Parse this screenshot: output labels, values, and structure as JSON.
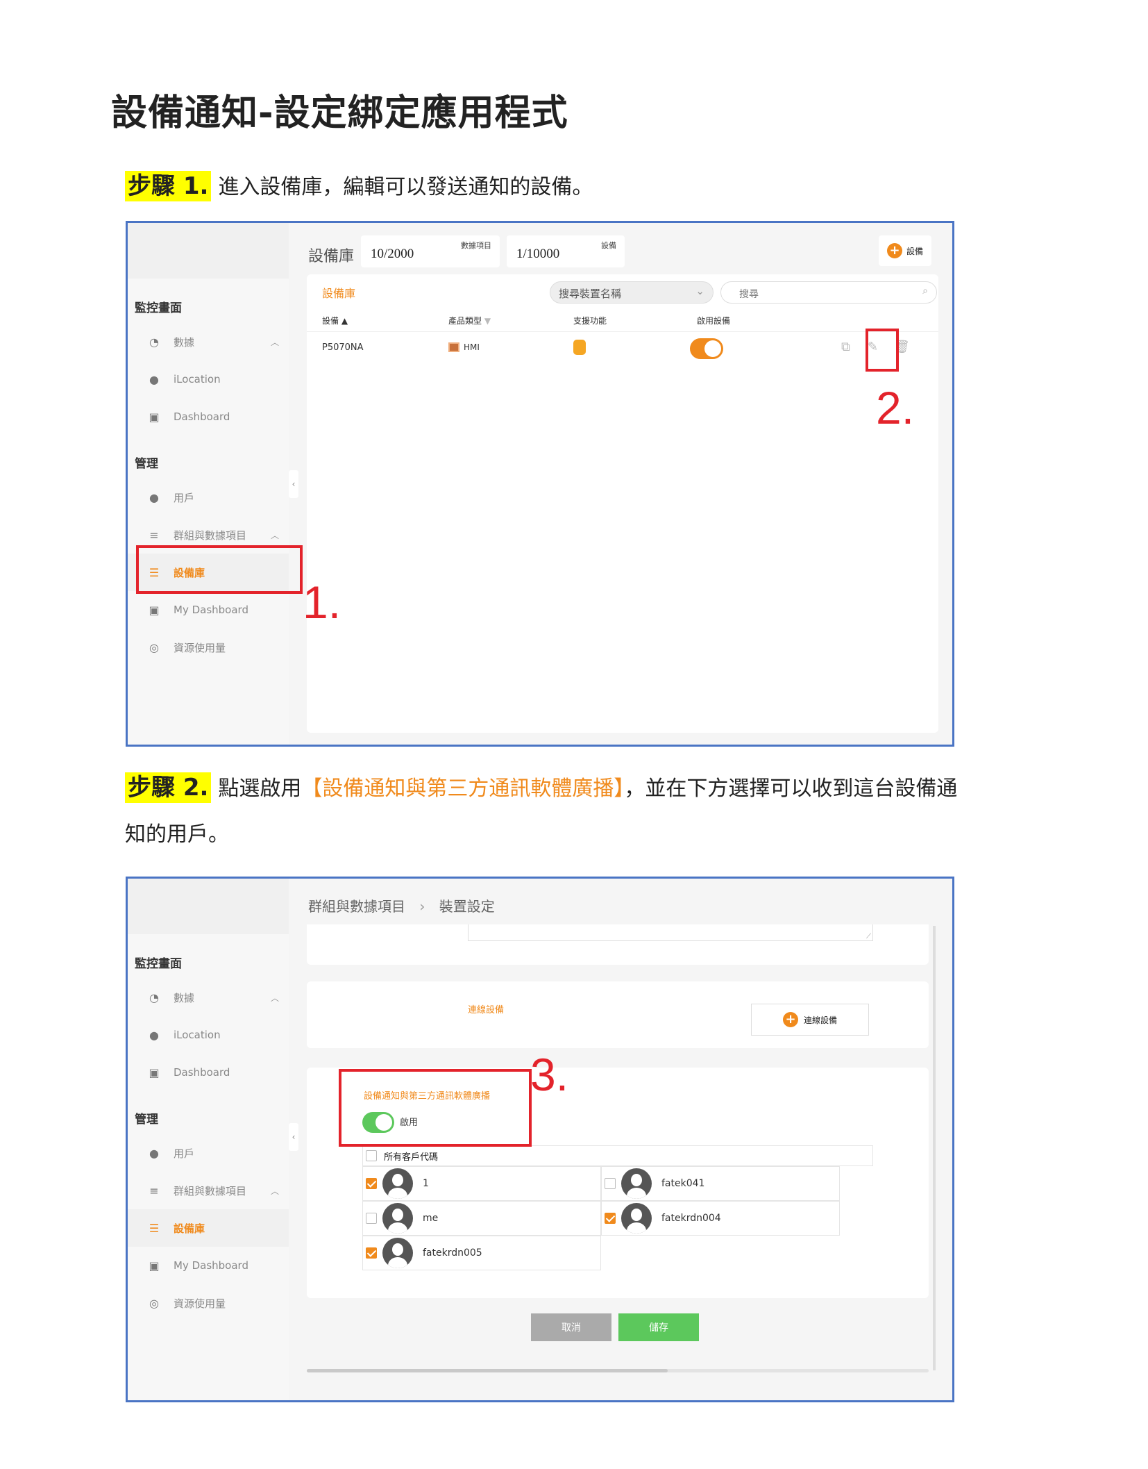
{
  "doc_title": "設備通知-設定綁定應用程式",
  "step1": {
    "tag": "步驟 1.",
    "text": "進入設備庫，編輯可以發送通知的設備。"
  },
  "step2": {
    "tag": "步驟 2.",
    "text_a": "點選啟用",
    "highlight": "【設備通知與第三方通訊軟體廣播】",
    "text_b": "，並在下方選擇可以收到這台設備通",
    "text_c": "知的用戶。"
  },
  "sidebar": {
    "section_monitor": "監控畫面",
    "section_manage": "管理",
    "items": [
      {
        "label": "數據",
        "icon": "dashboard-gauge-icon"
      },
      {
        "label": "iLocation",
        "icon": "location-pin-icon"
      },
      {
        "label": "Dashboard",
        "icon": "dashboard-icon"
      },
      {
        "label": "用戶",
        "icon": "user-icon"
      },
      {
        "label": "群組與數據項目",
        "icon": "database-group-icon"
      },
      {
        "label": "設備庫",
        "icon": "device-list-icon"
      },
      {
        "label": "My Dashboard",
        "icon": "my-dashboard-icon"
      },
      {
        "label": "資源使用量",
        "icon": "resource-usage-icon"
      }
    ]
  },
  "screen1": {
    "header_title": "設備庫",
    "stat1_value": "10/2000",
    "stat1_label": "數據項目",
    "stat2_value": "1/10000",
    "stat2_label": "設備",
    "add_button": "設備",
    "tab_title": "設備庫",
    "search_select": "搜尋裝置名稱",
    "search_placeholder": "搜尋",
    "columns": [
      "設備",
      "產品類型",
      "支援功能",
      "啟用設備"
    ],
    "row": {
      "device": "P5070NA",
      "type": "HMI",
      "enabled": true
    },
    "marker1": "1.",
    "marker2": "2."
  },
  "screen2": {
    "breadcrumb_parent": "群組與數據項目",
    "breadcrumb_sep": "›",
    "breadcrumb_current": "裝置設定",
    "connect_label": "連線設備",
    "connect_button": "連線設備",
    "notify_title": "設備通知與第三方通訊軟體廣播",
    "enable_label": "啟用",
    "all_codes": "所有客戶代碼",
    "users": [
      {
        "name": "1",
        "checked": true
      },
      {
        "name": "fatek041",
        "checked": false
      },
      {
        "name": "me",
        "checked": false
      },
      {
        "name": "fatekrdn004",
        "checked": true
      },
      {
        "name": "fatekrdn005",
        "checked": true
      }
    ],
    "cancel": "取消",
    "save": "儲存",
    "marker3": "3."
  }
}
